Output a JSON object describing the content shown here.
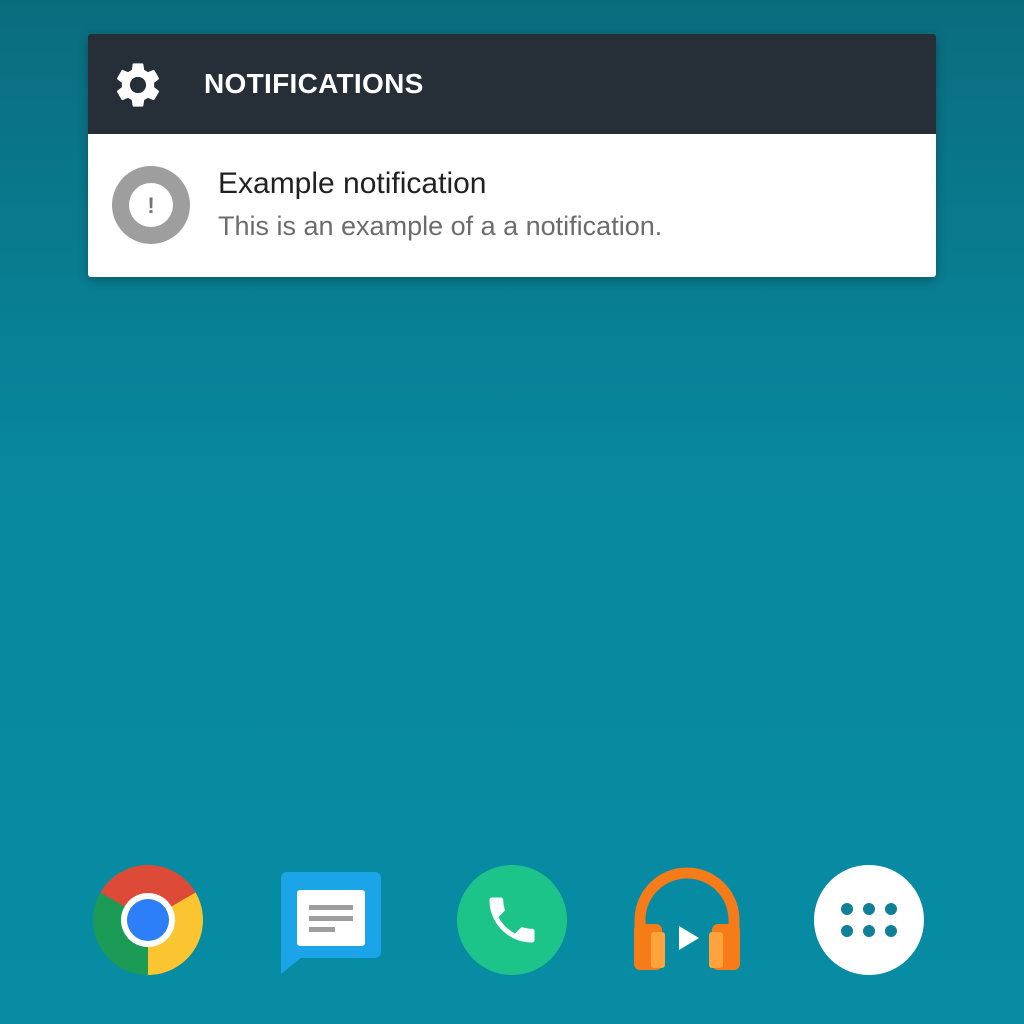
{
  "notifications_widget": {
    "title": "NOTIFICATIONS",
    "settings_icon": "gear-icon",
    "items": [
      {
        "icon": "alert-icon",
        "icon_glyph": "!",
        "title": "Example notification",
        "body": "This is an example of a a notification."
      }
    ]
  },
  "dock": {
    "apps": [
      {
        "name": "Chrome",
        "icon": "chrome-icon"
      },
      {
        "name": "Messages",
        "icon": "messages-icon"
      },
      {
        "name": "Phone",
        "icon": "phone-icon"
      },
      {
        "name": "Play Music",
        "icon": "headphones-icon"
      },
      {
        "name": "App drawer",
        "icon": "app-drawer-icon"
      }
    ]
  },
  "colors": {
    "wallpaper_top": "#0a6d7e",
    "wallpaper_bottom": "#078ca4",
    "header_bg": "#262f37",
    "item_bg": "#ffffff",
    "alert_icon_bg": "#9e9e9e"
  }
}
